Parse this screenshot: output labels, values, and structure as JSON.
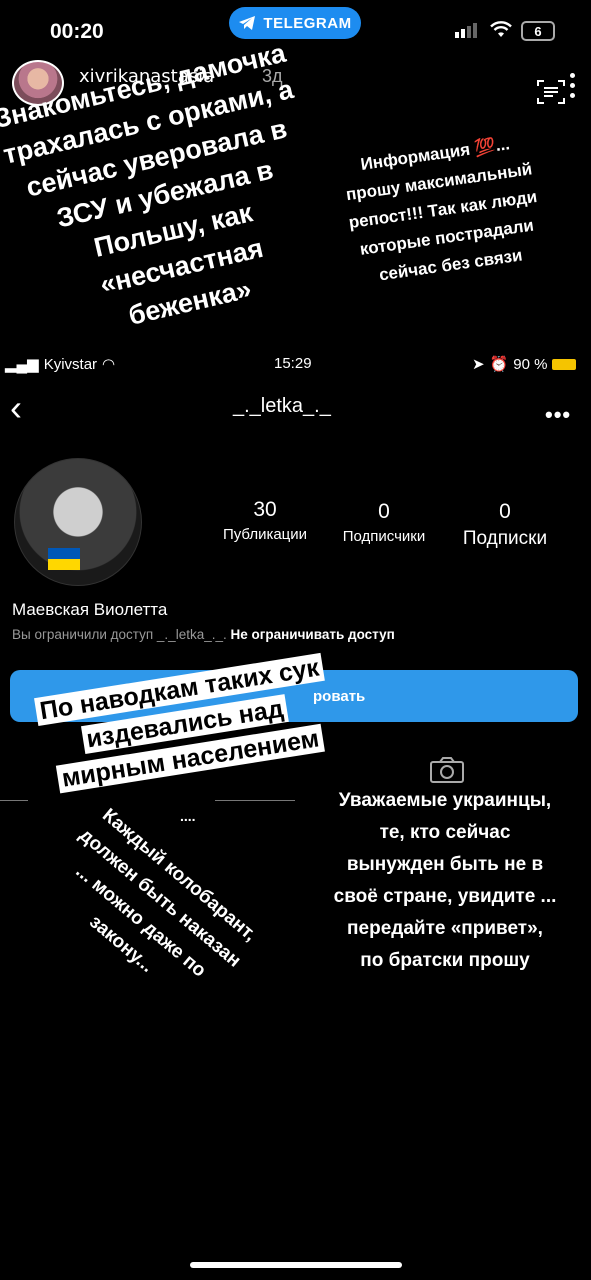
{
  "status_bar": {
    "time": "00:20",
    "app_pill": "TELEGRAM",
    "battery": "6"
  },
  "story_header": {
    "username": "xivrikanastasia",
    "posted_ago": "3д"
  },
  "stickers": {
    "top_left": [
      "Знакомьтесь, дамочка",
      "трахалась с орками, а",
      "сейчас уверовала в",
      "ЗСУ и убежала в",
      "Польшу, как",
      "«несчастная",
      "беженка»"
    ],
    "top_right": [
      "Информация 💯...",
      "прошу максимальный",
      "репост!!! Так как люди",
      "которые пострадали",
      "сейчас без связи"
    ],
    "middle": [
      "По наводкам таких сук",
      "издевались над",
      "мирным населением"
    ],
    "middle_dots": "....",
    "diagonal": [
      "Каждый колобарант,",
      "должен быть наказан",
      "... можно даже по",
      "закону..."
    ],
    "right_block": [
      "Уважаемые украинцы,",
      "те, кто сейчас",
      "вынужден быть не в",
      "своё стране, увидите ...",
      "передайте «привет»,",
      "по братски прошу"
    ]
  },
  "inner_screenshot": {
    "carrier": "Kyivstar",
    "time": "15:29",
    "battery": "90 %",
    "username": "_._letka_._",
    "stats": [
      {
        "value": "30",
        "label": "Публикации"
      },
      {
        "value": "0",
        "label": "Подписчики"
      },
      {
        "value": "0",
        "label": "Подписки"
      }
    ],
    "full_name": "Маевская Виолетта",
    "restrict_note": "Вы ограничили доступ _._letka_._.",
    "restrict_action": "Не ограничивать доступ",
    "button_fragment": "ровать"
  },
  "colors": {
    "telegram_blue": "#1d8cf0",
    "ig_button_blue": "#2f98ea",
    "battery_yellow": "#f5c400",
    "flag_blue": "#0057b7",
    "flag_yellow": "#ffd700"
  }
}
